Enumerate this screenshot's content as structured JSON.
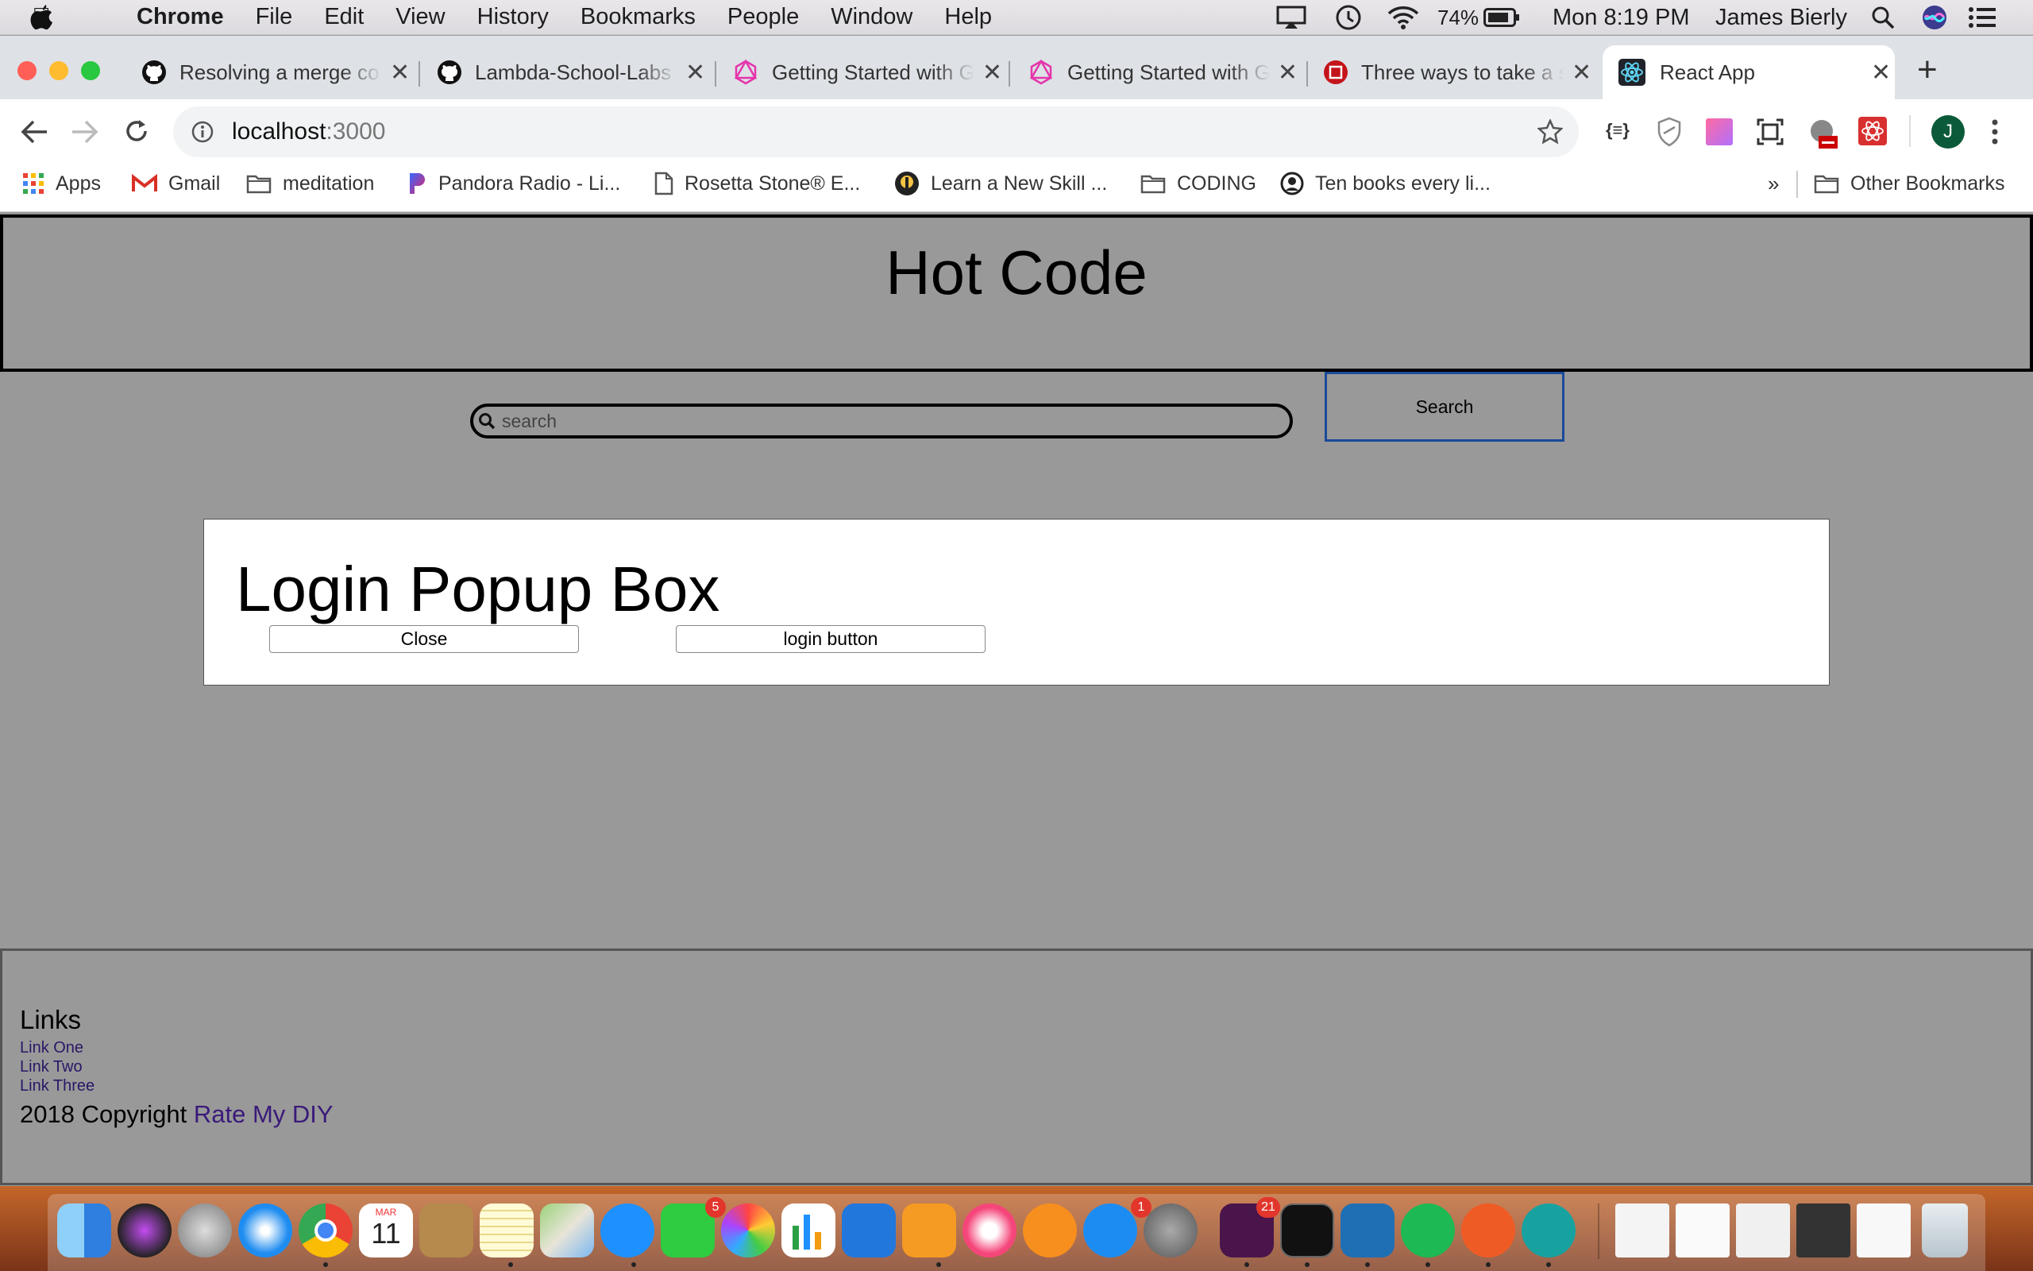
{
  "menubar": {
    "app": "Chrome",
    "items": [
      "File",
      "Edit",
      "View",
      "History",
      "Bookmarks",
      "People",
      "Window",
      "Help"
    ],
    "battery": "74%",
    "clock": "Mon 8:19 PM",
    "user": "James Bierly"
  },
  "tabs": [
    {
      "title": "Resolving a merge co",
      "icon": "github-icon"
    },
    {
      "title": "Lambda-School-Labs",
      "icon": "github-icon"
    },
    {
      "title": "Getting Started with G",
      "icon": "graphql-icon"
    },
    {
      "title": "Getting Started with G",
      "icon": "graphql-icon"
    },
    {
      "title": "Three ways to take a s",
      "icon": "codecademy-icon"
    },
    {
      "title": "React App",
      "icon": "react-icon",
      "active": true
    }
  ],
  "address": {
    "host": "localhost",
    "port": ":3000"
  },
  "profile_initial": "J",
  "bookmarks": [
    {
      "label": "Apps",
      "icon": "apps-grid-icon"
    },
    {
      "label": "Gmail",
      "icon": "gmail-icon"
    },
    {
      "label": "meditation",
      "icon": "folder-icon"
    },
    {
      "label": "Pandora Radio - Li...",
      "icon": "pandora-icon"
    },
    {
      "label": "Rosetta Stone® E...",
      "icon": "page-icon"
    },
    {
      "label": "Learn a New Skill ...",
      "icon": "lynda-icon"
    },
    {
      "label": "CODING",
      "icon": "folder-icon"
    },
    {
      "label": "Ten books every li...",
      "icon": "site-icon"
    }
  ],
  "bookmarks_overflow": "»",
  "other_bookmarks": "Other Bookmarks",
  "page": {
    "header_title": "Hot Code",
    "search_placeholder": "search",
    "search_button": "Search",
    "popup": {
      "title": "Login Popup Box",
      "close_button": "Close",
      "login_button": "login button"
    },
    "footer": {
      "links_heading": "Links",
      "links": [
        "Link One",
        "Link Two",
        "Link Three"
      ],
      "copyright_prefix": "2018 Copyright",
      "copyright_link": "Rate My DIY"
    }
  },
  "dock": {
    "apps": [
      "finder",
      "siri",
      "launchpad",
      "safari",
      "chrome",
      "calendar",
      "contacts",
      "notes",
      "maps",
      "messages",
      "facetime",
      "photos",
      "numbers",
      "keynote",
      "pages",
      "itunes",
      "books",
      "app-store",
      "system-preferences",
      "slack",
      "terminal",
      "vscode",
      "spotify",
      "postman",
      "surfshark"
    ],
    "calendar": {
      "month": "MAR",
      "day": "11"
    },
    "badges": {
      "facetime": "5",
      "app-store": "1",
      "slack": "21"
    }
  }
}
